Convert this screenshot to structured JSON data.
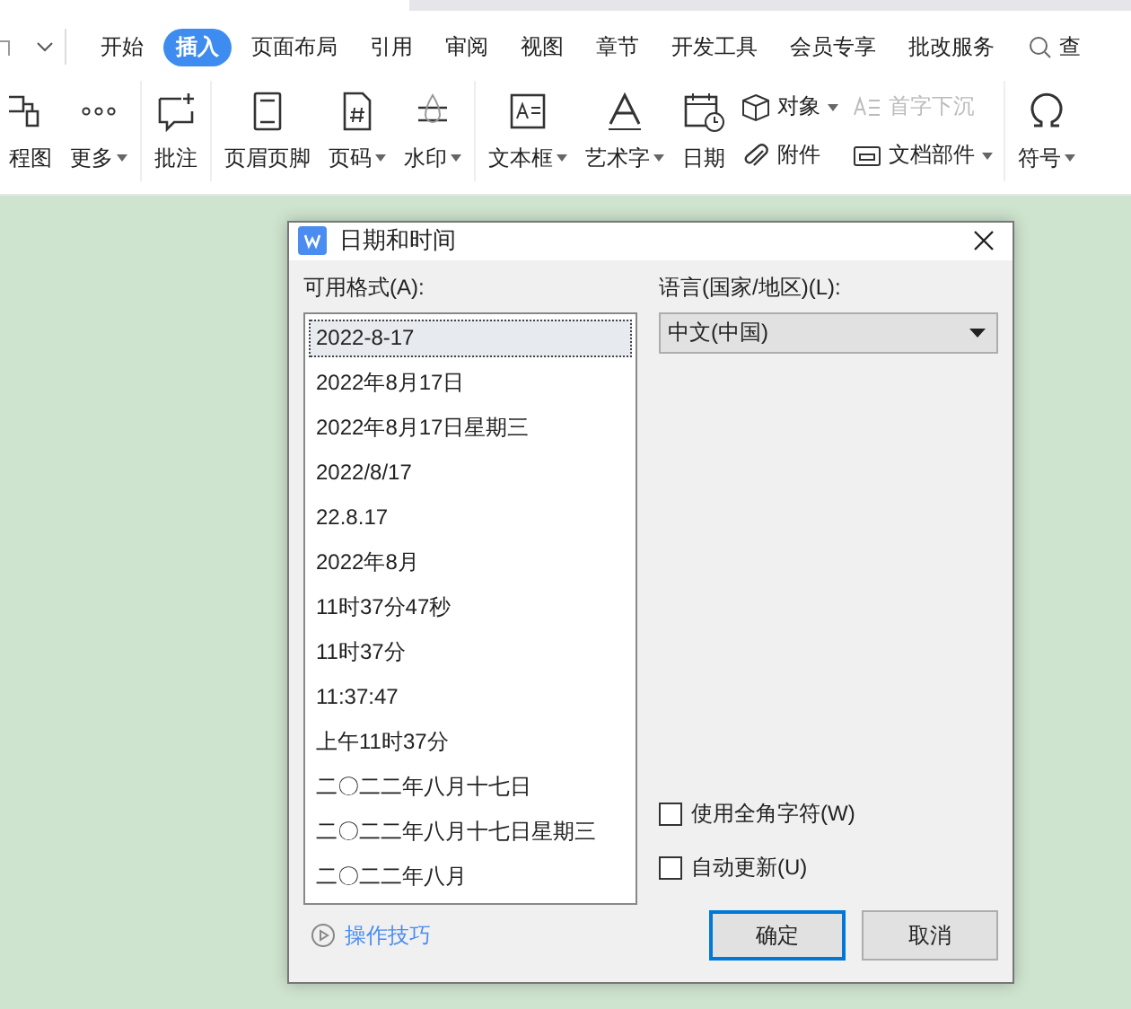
{
  "menu_tabs": [
    {
      "label": "开始",
      "selected": false
    },
    {
      "label": "插入",
      "selected": true
    },
    {
      "label": "页面布局",
      "selected": false
    },
    {
      "label": "引用",
      "selected": false
    },
    {
      "label": "审阅",
      "selected": false
    },
    {
      "label": "视图",
      "selected": false
    },
    {
      "label": "章节",
      "selected": false
    },
    {
      "label": "开发工具",
      "selected": false
    },
    {
      "label": "会员专享",
      "selected": false
    },
    {
      "label": "批改服务",
      "selected": false
    }
  ],
  "search": {
    "label": "查"
  },
  "ribbon": [
    {
      "kind": "large",
      "label": "程图",
      "dropdown": false
    },
    {
      "kind": "large",
      "label": "更多",
      "dropdown": true
    },
    {
      "kind": "large",
      "label": "批注",
      "dropdown": false
    },
    {
      "kind": "large",
      "label": "页眉页脚",
      "dropdown": false
    },
    {
      "kind": "large",
      "label": "页码",
      "dropdown": true
    },
    {
      "kind": "large",
      "label": "水印",
      "dropdown": true
    },
    {
      "kind": "large",
      "label": "文本框",
      "dropdown": true
    },
    {
      "kind": "large",
      "label": "艺术字",
      "dropdown": true
    },
    {
      "kind": "large",
      "label": "日期",
      "dropdown": false
    },
    {
      "kind": "small",
      "label": "对象",
      "dropdown": true,
      "disabled": false
    },
    {
      "kind": "small",
      "label": "附件",
      "dropdown": false,
      "disabled": false
    },
    {
      "kind": "small",
      "label": "首字下沉",
      "dropdown": false,
      "disabled": true
    },
    {
      "kind": "small",
      "label": "文档部件",
      "dropdown": true,
      "disabled": false
    },
    {
      "kind": "large",
      "label": "符号",
      "dropdown": true
    }
  ],
  "dialog": {
    "title": "日期和时间",
    "formats_label": "可用格式(A):",
    "formats": [
      {
        "text": "2022-8-17",
        "selected": true
      },
      {
        "text": "2022年8月17日",
        "selected": false
      },
      {
        "text": "2022年8月17日星期三",
        "selected": false
      },
      {
        "text": "2022/8/17",
        "selected": false
      },
      {
        "text": "22.8.17",
        "selected": false
      },
      {
        "text": "2022年8月",
        "selected": false
      },
      {
        "text": "11时37分47秒",
        "selected": false
      },
      {
        "text": "11时37分",
        "selected": false
      },
      {
        "text": "11:37:47",
        "selected": false
      },
      {
        "text": "上午11时37分",
        "selected": false
      },
      {
        "text": "二〇二二年八月十七日",
        "selected": false
      },
      {
        "text": "二〇二二年八月十七日星期三",
        "selected": false
      },
      {
        "text": "二〇二二年八月",
        "selected": false
      }
    ],
    "language_label": "语言(国家/地区)(L):",
    "language_value": "中文(中国)",
    "checkboxes": [
      {
        "label": "使用全角字符(W)",
        "checked": false
      },
      {
        "label": "自动更新(U)",
        "checked": false
      }
    ],
    "tips_link": "操作技巧",
    "buttons": [
      {
        "label": "确定",
        "focused": true
      },
      {
        "label": "取消",
        "focused": false
      }
    ]
  }
}
